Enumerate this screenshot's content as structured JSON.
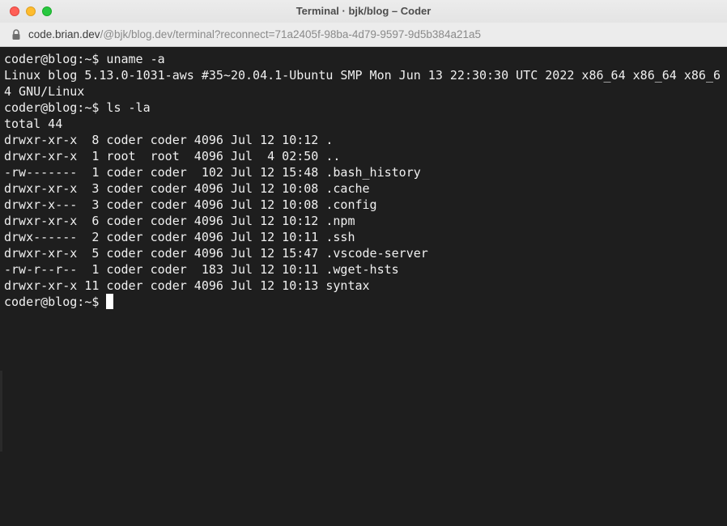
{
  "window": {
    "title": "Terminal · bjk/blog – Coder"
  },
  "urlbar": {
    "host": "code.brian.dev",
    "path": "/@bjk/blog.dev/terminal?reconnect=71a2405f-98ba-4d79-9597-9d5b384a21a5"
  },
  "colors": {
    "terminal_bg": "#1e1e1e",
    "terminal_fg": "#f0f0f0",
    "close": "#ff5f57",
    "minimize": "#febc2e",
    "zoom": "#28c840"
  },
  "icons": {
    "lock": "lock-icon"
  },
  "terminal": {
    "lines": [
      "coder@blog:~$ uname -a",
      "Linux blog 5.13.0-1031-aws #35~20.04.1-Ubuntu SMP Mon Jun 13 22:30:30 UTC 2022 x86_64 x86_64 x86_6",
      "4 GNU/Linux",
      "coder@blog:~$ ls -la",
      "total 44",
      "drwxr-xr-x  8 coder coder 4096 Jul 12 10:12 .",
      "drwxr-xr-x  1 root  root  4096 Jul  4 02:50 ..",
      "-rw-------  1 coder coder  102 Jul 12 15:48 .bash_history",
      "drwxr-xr-x  3 coder coder 4096 Jul 12 10:08 .cache",
      "drwxr-x---  3 coder coder 4096 Jul 12 10:08 .config",
      "drwxr-xr-x  6 coder coder 4096 Jul 12 10:12 .npm",
      "drwx------  2 coder coder 4096 Jul 12 10:11 .ssh",
      "drwxr-xr-x  5 coder coder 4096 Jul 12 15:47 .vscode-server",
      "-rw-r--r--  1 coder coder  183 Jul 12 10:11 .wget-hsts",
      "drwxr-xr-x 11 coder coder 4096 Jul 12 10:13 syntax"
    ],
    "prompt": "coder@blog:~$ "
  }
}
